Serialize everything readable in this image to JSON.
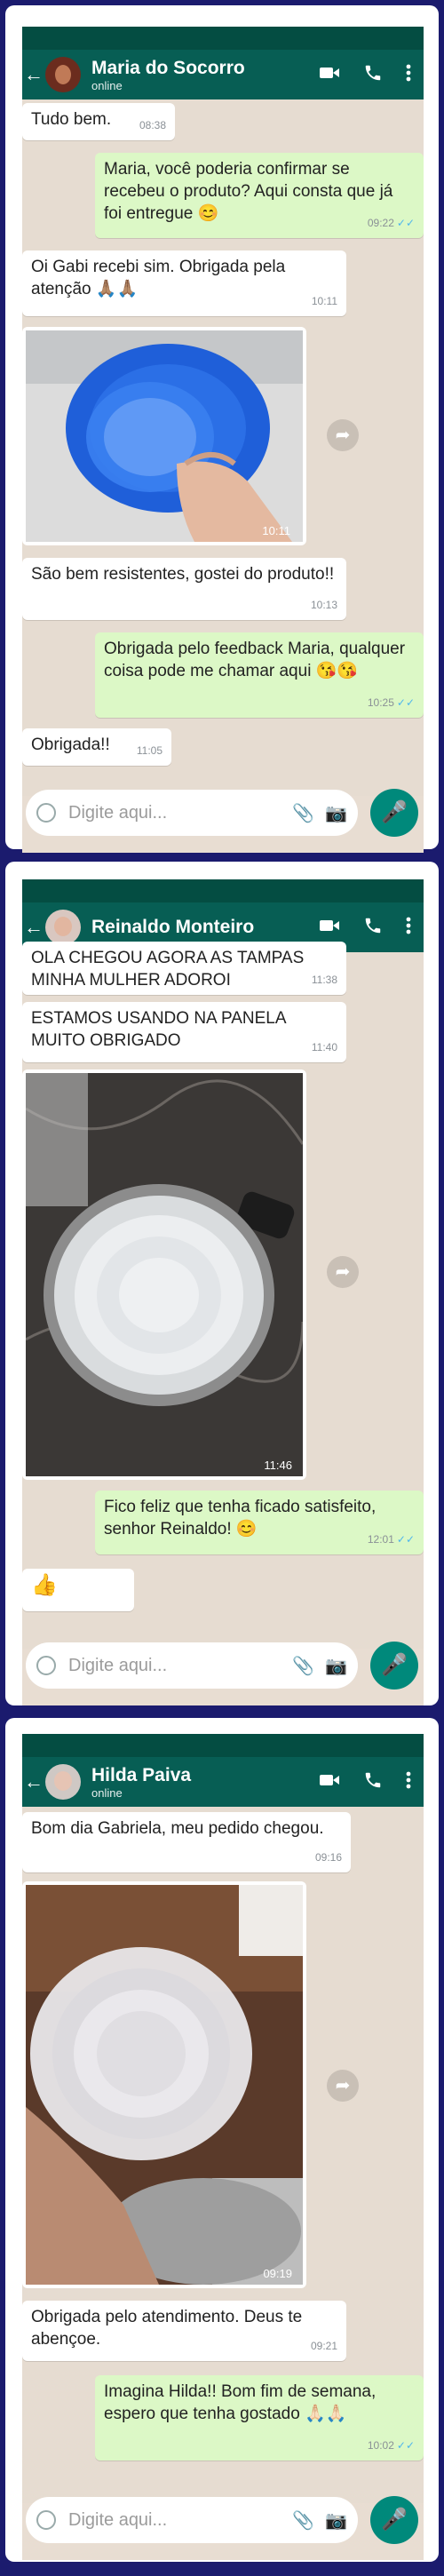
{
  "common": {
    "input_placeholder": "Digite aqui...",
    "back_icon": "arrow-left-icon",
    "video_icon": "video-camera-icon",
    "call_icon": "phone-icon",
    "menu_icon": "more-vert-icon",
    "emoji_icon": "smiley-icon",
    "clip_icon": "paperclip-icon",
    "camera_icon": "camera-icon",
    "mic_icon": "microphone-icon",
    "share_icon": "forward-share-icon"
  },
  "colors": {
    "header_green": "#075e54",
    "status_green": "#044d42",
    "outgoing_bubble": "#dcf8c6",
    "incoming_bubble": "#ffffff",
    "mic_button": "#00897b",
    "page_background": "#1b1b6e"
  },
  "chats": [
    {
      "contact": "Maria do Socorro",
      "status": "online",
      "messages": [
        {
          "type": "in",
          "text": "Tudo bem.",
          "time": "08:38"
        },
        {
          "type": "out",
          "text": "Maria, você poderia confirmar se recebeu o produto? Aqui consta que já foi entregue 😊",
          "time": "09:22",
          "read": "✓✓"
        },
        {
          "type": "in",
          "text": "Oi Gabi recebi sim. Obrigada pela atenção 🙏🏽🙏🏽",
          "time": "10:11"
        },
        {
          "type": "image",
          "time": "10:11"
        },
        {
          "type": "in",
          "text": "São bem resistentes, gostei do produto!!",
          "time": "10:13"
        },
        {
          "type": "out",
          "text": "Obrigada pelo feedback Maria, qualquer coisa pode me chamar aqui 😘😘",
          "time": "10:25",
          "read": "✓✓"
        },
        {
          "type": "in",
          "text": "Obrigada!!",
          "time": "11:05"
        }
      ]
    },
    {
      "contact": "Reinaldo Monteiro",
      "status": "",
      "messages": [
        {
          "type": "in",
          "text": "OLA CHEGOU AGORA AS TAMPAS MINHA MULHER ADOROI",
          "time": "11:38"
        },
        {
          "type": "in",
          "text": "ESTAMOS USANDO NA PANELA MUITO OBRIGADO",
          "time": "11:40"
        },
        {
          "type": "image",
          "time": "11:46"
        },
        {
          "type": "out",
          "text": "Fico feliz que tenha ficado satisfeito, senhor Reinaldo! 😊",
          "time": "12:01",
          "read": "✓✓"
        },
        {
          "type": "in",
          "text": "👍",
          "time": ""
        }
      ]
    },
    {
      "contact": "Hilda Paiva",
      "status": "online",
      "messages": [
        {
          "type": "in",
          "text": "Bom dia Gabriela, meu pedido chegou.",
          "time": "09:16"
        },
        {
          "type": "image",
          "time": "09:19"
        },
        {
          "type": "in",
          "text": "Obrigada pelo atendimento. Deus te abençoe.",
          "time": "09:21"
        },
        {
          "type": "out",
          "text": "Imagina Hilda!! Bom fim de semana, espero que tenha gostado 🙏🏻🙏🏻",
          "time": "10:02",
          "read": "✓✓"
        }
      ]
    }
  ]
}
